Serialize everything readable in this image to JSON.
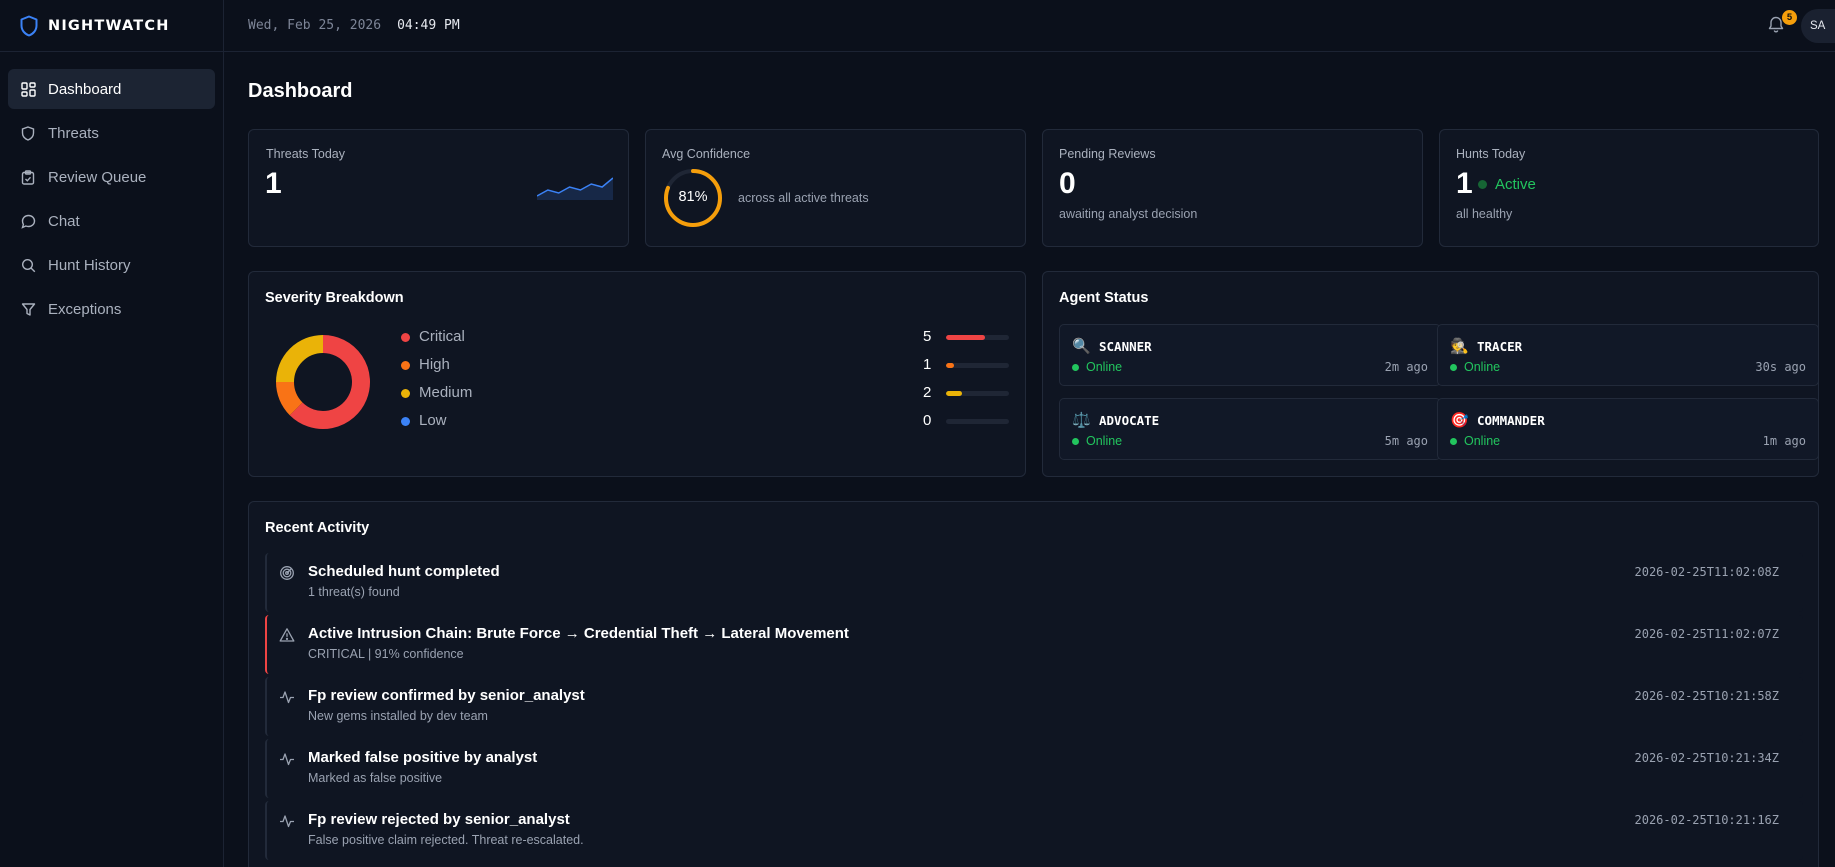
{
  "app": {
    "brand": "NIGHTWATCH"
  },
  "header": {
    "date": "Wed, Feb 25, 2026",
    "time": "04:49 PM",
    "notification_count": "5",
    "avatar_initials": "SA"
  },
  "sidebar": {
    "items": [
      {
        "label": "Dashboard",
        "icon": "dashboard-icon",
        "active": true
      },
      {
        "label": "Threats",
        "icon": "shield-icon"
      },
      {
        "label": "Review Queue",
        "icon": "clipboard-icon"
      },
      {
        "label": "Chat",
        "icon": "chat-icon"
      },
      {
        "label": "Hunt History",
        "icon": "search-icon"
      },
      {
        "label": "Exceptions",
        "icon": "filter-icon"
      }
    ]
  },
  "page": {
    "title": "Dashboard"
  },
  "stats": {
    "threats_today": {
      "label": "Threats Today",
      "value": "1",
      "trend": [
        2,
        4,
        3,
        5,
        4,
        6,
        5,
        8
      ]
    },
    "avg_confidence": {
      "label": "Avg Confidence",
      "value": "81%",
      "fraction": 0.81,
      "description": "across all active threats"
    },
    "pending_reviews": {
      "label": "Pending Reviews",
      "value": "0",
      "description": "awaiting analyst decision"
    },
    "hunts_today": {
      "label": "Hunts Today",
      "value": "1",
      "status": "Active",
      "description": "all healthy"
    }
  },
  "severity": {
    "title": "Severity Breakdown",
    "items": [
      {
        "name": "Critical",
        "count": "5",
        "color": "#ef4444",
        "fraction": 0.625
      },
      {
        "name": "High",
        "count": "1",
        "color": "#f97316",
        "fraction": 0.125
      },
      {
        "name": "Medium",
        "count": "2",
        "color": "#eab308",
        "fraction": 0.25
      },
      {
        "name": "Low",
        "count": "0",
        "color": "#3b82f6",
        "fraction": 0
      }
    ]
  },
  "agents": {
    "title": "Agent Status",
    "items": [
      {
        "name": "SCANNER",
        "emoji": "🔍",
        "status": "Online",
        "ago": "2m ago"
      },
      {
        "name": "TRACER",
        "emoji": "🕵️",
        "status": "Online",
        "ago": "30s ago"
      },
      {
        "name": "ADVOCATE",
        "emoji": "⚖️",
        "status": "Online",
        "ago": "5m ago"
      },
      {
        "name": "COMMANDER",
        "emoji": "🎯",
        "status": "Online",
        "ago": "1m ago"
      }
    ]
  },
  "activity": {
    "title": "Recent Activity",
    "items": [
      {
        "icon": "radar-icon",
        "title": "Scheduled hunt completed",
        "subtitle": "1 threat(s) found",
        "time": "2026-02-25T11:02:08Z"
      },
      {
        "icon": "warning-icon",
        "title": "Active Intrusion Chain: Brute Force → Credential Theft → Lateral Movement",
        "subtitle": "CRITICAL | 91% confidence",
        "time": "2026-02-25T11:02:07Z",
        "critical": true
      },
      {
        "icon": "pulse-icon",
        "title": "Fp review confirmed by senior_analyst",
        "subtitle": "New gems installed by dev team",
        "time": "2026-02-25T10:21:58Z"
      },
      {
        "icon": "pulse-icon",
        "title": "Marked false positive by analyst",
        "subtitle": "Marked as false positive",
        "time": "2026-02-25T10:21:34Z"
      },
      {
        "icon": "pulse-icon",
        "title": "Fp review rejected by senior_analyst",
        "subtitle": "False positive claim rejected. Threat re-escalated.",
        "time": "2026-02-25T10:21:16Z"
      }
    ]
  },
  "colors": {
    "accent": "#3b82f6",
    "success": "#22c55e",
    "warning": "#f59e0b",
    "critical": "#ef4444"
  }
}
